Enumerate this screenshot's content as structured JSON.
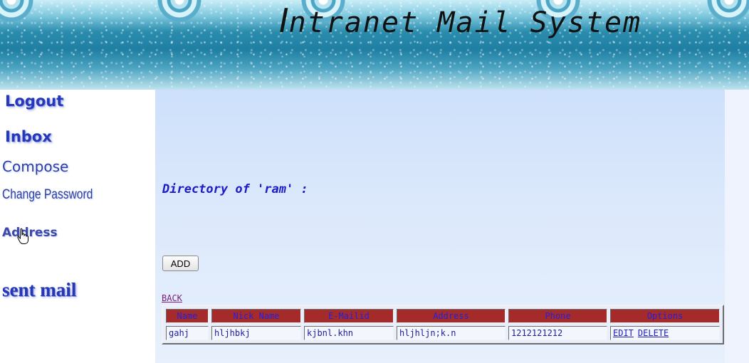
{
  "banner": {
    "title_first": "I",
    "title_rest": "ntranet Mail System"
  },
  "sidebar": {
    "items": [
      {
        "label": "Logout"
      },
      {
        "label": "Inbox"
      },
      {
        "label": "Compose"
      },
      {
        "label": "Change Password"
      },
      {
        "label": "Address"
      },
      {
        "label": "sent mail"
      }
    ]
  },
  "main": {
    "heading": "Directory of 'ram' :",
    "add_label": "ADD",
    "back_label": "BACK",
    "table": {
      "headers": [
        "Name",
        "Nick Name",
        "E-Mailid",
        "Address",
        "Phone",
        "Options"
      ],
      "rows": [
        {
          "name": "gahj",
          "nick": "hljhbkj",
          "email": "kjbnl.khn",
          "address": "hljhljn;k.n",
          "phone": "1212121212",
          "edit": "EDIT",
          "delete": "DELETE"
        }
      ]
    }
  },
  "colors": {
    "header_cell": "#a52a2a",
    "header_text": "#2222dd",
    "heading_text": "#1c1cc8",
    "nav_text": "#2438b8"
  },
  "icons": [
    "hand-pointer-cursor-icon"
  ]
}
